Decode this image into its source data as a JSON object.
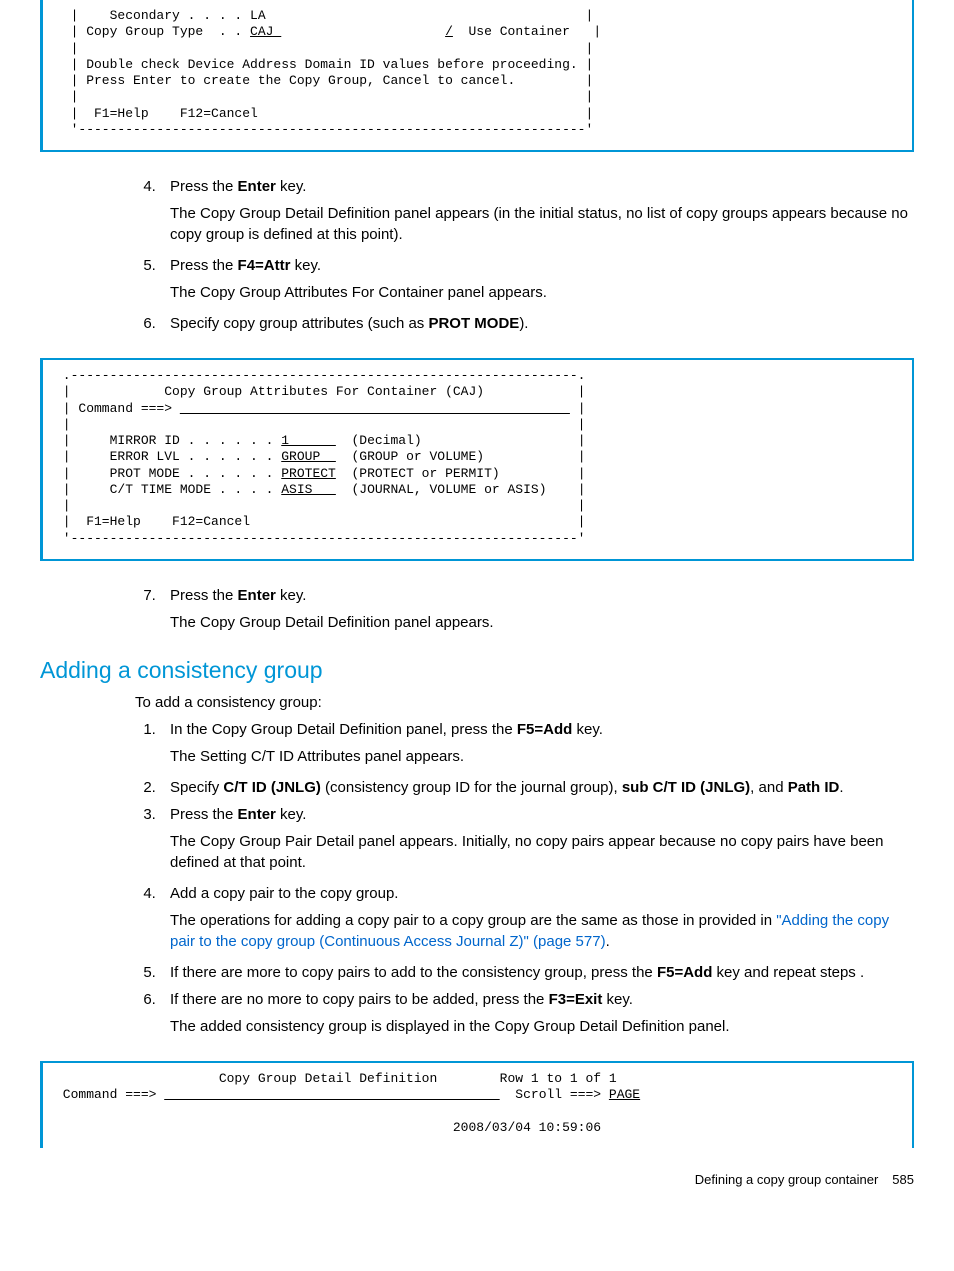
{
  "term1": {
    "l1": "  |    Secondary . . . . LA                                         |",
    "l2a": "  | Copy Group Type  . . ",
    "l2u": "CAJ ",
    "l2b": "                     ",
    "l2s": "/",
    "l2c": "  Use Container   |",
    "l3": "  |                                                                 |",
    "l4": "  | Double check Device Address Domain ID values before proceeding. |",
    "l5": "  | Press Enter to create the Copy Group, Cancel to cancel.         |",
    "l6": "  |                                                                 |",
    "l7": "  |  F1=Help    F12=Cancel                                          |",
    "l8": "  '-----------------------------------------------------------------'"
  },
  "stepsA": {
    "s4_lead": "Press the ",
    "s4_b": "Enter",
    "s4_tail": " key.",
    "s4_body": "The Copy Group Detail Definition panel appears (in the initial status, no list of copy groups appears because no copy group is defined at this point).",
    "s5_lead": "Press the ",
    "s5_b": "F4=Attr",
    "s5_tail": " key.",
    "s5_body": "The Copy Group Attributes For Container panel appears.",
    "s6_lead": "Specify copy group attributes (such as ",
    "s6_b": "PROT MODE",
    "s6_tail": ")."
  },
  "term2": {
    "l0": " .-----------------------------------------------------------------.",
    "l1": " |            Copy Group Attributes For Container (CAJ)            |",
    "l2a": " | Command ===> ",
    "l2u": "                                                  ",
    "l2b": " |",
    "l3": " |                                                                 |",
    "l4a": " |     MIRROR ID . . . . . . ",
    "l4u": "1      ",
    "l4b": "  (Decimal)                    |",
    "l5a": " |     ERROR LVL . . . . . . ",
    "l5u": "GROUP  ",
    "l5b": "  (GROUP or VOLUME)            |",
    "l6a": " |     PROT MODE . . . . . . ",
    "l6u": "PROTECT",
    "l6b": "  (PROTECT or PERMIT)          |",
    "l7a": " |     C/T TIME MODE . . . . ",
    "l7u": "ASIS   ",
    "l7b": "  (JOURNAL, VOLUME or ASIS)    |",
    "l8": " |                                                                 |",
    "l9": " |  F1=Help    F12=Cancel                                          |",
    "l10": " '-----------------------------------------------------------------'"
  },
  "stepsA2": {
    "s7_lead": "Press the ",
    "s7_b": "Enter",
    "s7_tail": " key.",
    "s7_body": "The Copy Group Detail Definition panel appears."
  },
  "section2": "Adding a consistency group",
  "intro2": "To add a consistency group:",
  "stepsB": {
    "s1_lead": "In the Copy Group Detail Definition panel, press the ",
    "s1_b": "F5=Add",
    "s1_tail": " key.",
    "s1_body": "The Setting C/T ID Attributes panel appears.",
    "s2_lead": "Specify ",
    "s2_b1": "C/T ID (JNLG)",
    "s2_mid1": " (consistency group ID for the journal group), ",
    "s2_b2": "sub C/T ID (JNLG)",
    "s2_mid2": ", and ",
    "s2_b3": "Path ID",
    "s2_tail": ".",
    "s3_lead": "Press the ",
    "s3_b": "Enter",
    "s3_tail": " key.",
    "s3_body": "The Copy Group Pair Detail panel appears. Initially, no copy pairs appear because no copy pairs have been defined at that point.",
    "s4_text": "Add a copy pair to the copy group.",
    "s4_body_lead": "The operations for adding a copy pair to a copy group are the same as those in provided in ",
    "s4_link": "\"Adding the copy pair to the copy group (Continuous Access Journal Z)\" (page 577)",
    "s4_body_tail": ".",
    "s5_lead": "If there are more to copy pairs to add to the consistency group, press the ",
    "s5_b": "F5=Add",
    "s5_tail": " key and repeat steps .",
    "s6_lead": "If there are no more to copy pairs to be added, press the ",
    "s6_b": "F3=Exit",
    "s6_tail": " key.",
    "s6_body": "The added consistency group is displayed in the Copy Group Detail Definition panel."
  },
  "term3": {
    "l1": "                     Copy Group Detail Definition        Row 1 to 1 of 1",
    "l2a": " Command ===> ",
    "l2u": "                                           ",
    "l2b": "  Scroll ===> ",
    "l2u2": "PAGE",
    "l3": " ",
    "l4": "                                                   2008/03/04 10:59:06"
  },
  "footer": {
    "text": "Defining a copy group container",
    "page": "585"
  }
}
